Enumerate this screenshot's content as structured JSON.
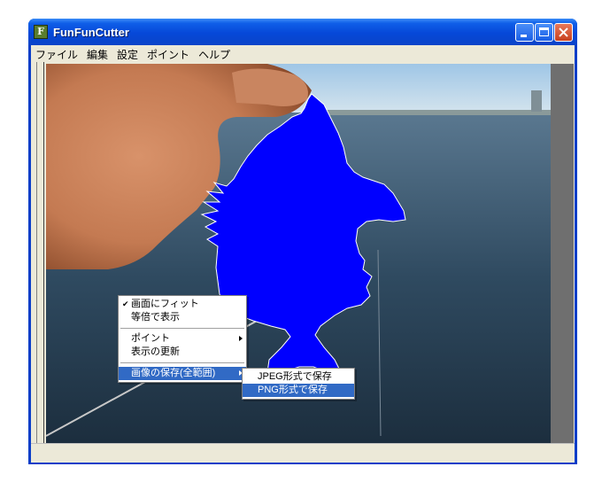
{
  "window": {
    "title": "FunFunCutter",
    "icon_letter": "F",
    "accent_color": "#0a3ec8"
  },
  "menu": [
    "ファイル",
    "編集",
    "設定",
    "ポイント",
    "ヘルプ"
  ],
  "context_menu": {
    "items": [
      {
        "label": "画面にフィット",
        "checked": true
      },
      {
        "label": "等倍で表示"
      },
      {
        "label": "ポイント",
        "submenu": true
      },
      {
        "label": "表示の更新"
      },
      {
        "label": "画像の保存(全範囲)",
        "submenu": true,
        "highlighted": true
      }
    ]
  },
  "submenu": {
    "items": [
      {
        "label": "JPEG形式で保存"
      },
      {
        "label": "PNG形式で保存",
        "highlighted": true
      }
    ]
  },
  "cutout_color": "#0000ff"
}
